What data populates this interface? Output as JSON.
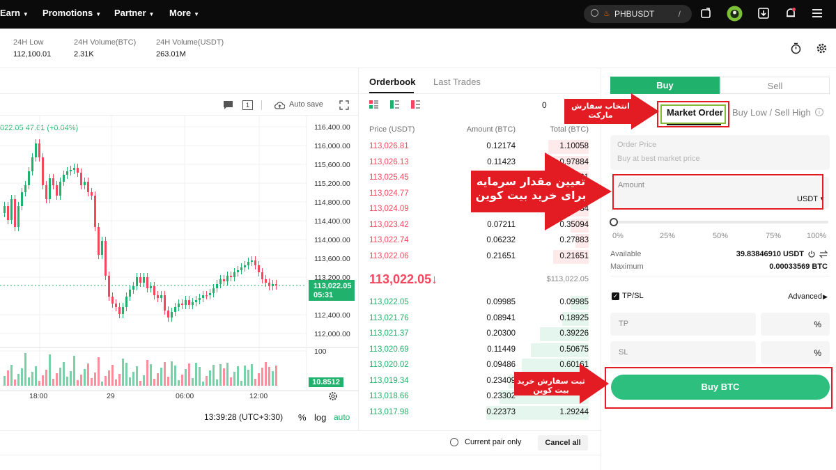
{
  "nav": {
    "items": [
      "Earn",
      "Promotions",
      "Partner",
      "More"
    ],
    "search_text": "PHBUSDT",
    "search_slash": "/"
  },
  "stats": [
    {
      "label": "24H Low",
      "value": "112,100.01"
    },
    {
      "label": "24H Volume(BTC)",
      "value": "2.31K"
    },
    {
      "label": "24H Volume(USDT)",
      "value": "263.01M"
    }
  ],
  "chart": {
    "autosave_label": "Auto save",
    "interval_badge": "1",
    "ohlc_text": "022.05  47.61 (+0.04%)",
    "price_ticks": [
      "116,400.00",
      "116,000.00",
      "115,600.00",
      "115,200.00",
      "114,800.00",
      "114,400.00",
      "114,000.00",
      "113,600.00",
      "113,200.00",
      "112,400.00",
      "112,000.00",
      "100"
    ],
    "current_price": "113,022.05",
    "countdown": "05:31",
    "volume_value": "10.8512",
    "time_ticks": [
      "18:00",
      "29",
      "06:00",
      "12:00"
    ],
    "clock": "13:39:28 (UTC+3:30)",
    "scale_pct": "%",
    "scale_log": "log",
    "scale_auto": "auto"
  },
  "orderbook": {
    "tabs": [
      "Orderbook",
      "Last Trades"
    ],
    "headers": {
      "price": "Price (USDT)",
      "amount": "Amount (BTC)",
      "total": "Total (BTC)"
    },
    "precision_stub": "0",
    "asks": [
      {
        "price": "113,026.81",
        "amount": "0.12174",
        "total": "1.10058",
        "depth": 0.18
      },
      {
        "price": "113,026.13",
        "amount": "0.11423",
        "total": "0.97884",
        "depth": 0.16
      },
      {
        "price": "113,025.45",
        "amount": "",
        "total": "61",
        "depth": 0.14
      },
      {
        "price": "113,024.77",
        "amount": "",
        "total": "",
        "depth": 0.12
      },
      {
        "price": "113,024.09",
        "amount": "",
        "total": "34",
        "depth": 0.1
      },
      {
        "price": "113,023.42",
        "amount": "0.07211",
        "total": "0.35094",
        "depth": 0.08
      },
      {
        "price": "113,022.74",
        "amount": "0.06232",
        "total": "0.27883",
        "depth": 0.06
      },
      {
        "price": "113,022.06",
        "amount": "0.21651",
        "total": "0.21651",
        "depth": 0.16
      }
    ],
    "last_price": "113,022.05",
    "last_arrow": "↓",
    "last_fiat": "$113,022.05",
    "bids": [
      {
        "price": "113,022.05",
        "amount": "0.09985",
        "total": "0.09985",
        "depth": 0.08
      },
      {
        "price": "113,021.76",
        "amount": "0.08941",
        "total": "0.18925",
        "depth": 0.12
      },
      {
        "price": "113,021.37",
        "amount": "0.20300",
        "total": "0.39226",
        "depth": 0.22
      },
      {
        "price": "113,020.69",
        "amount": "0.11449",
        "total": "0.50675",
        "depth": 0.26
      },
      {
        "price": "113,020.02",
        "amount": "0.09486",
        "total": "0.60161",
        "depth": 0.3
      },
      {
        "price": "113,019.34",
        "amount": "0.23409",
        "total": "",
        "depth": 0.36
      },
      {
        "price": "113,018.66",
        "amount": "0.23302",
        "total": "",
        "depth": 0.4
      },
      {
        "price": "113,017.98",
        "amount": "0.22373",
        "total": "1.29244",
        "depth": 0.46
      }
    ]
  },
  "bottom": {
    "current_pair_only": "Current pair only",
    "cancel_all": "Cancel all"
  },
  "form": {
    "buy_tab": "Buy",
    "sell_tab": "Sell",
    "market_order": "Market Order",
    "buy_low_sell_high": "Buy Low / Sell High",
    "order_price_label": "Order Price",
    "order_price_placeholder": "Buy at best market price",
    "amount_label": "Amount",
    "amount_unit": "USDT",
    "slider_marks": [
      "0%",
      "25%",
      "50%",
      "75%",
      "100%"
    ],
    "slider_fraction": 0,
    "available_label": "Available",
    "available_value": "39.83846910 USDT",
    "maximum_label": "Maximum",
    "maximum_value": "0.00033569 BTC",
    "tpsl_label": "TP/SL",
    "advanced_label": "Advanced",
    "tp_label": "TP",
    "sl_label": "SL",
    "pct": "%",
    "buy_button": "Buy BTC"
  },
  "annotations": {
    "market_order_note_1": "انتخاب سفارش",
    "market_order_note_2": "مارکت",
    "amount_note_1": "تعیین مقدار سرمایه",
    "amount_note_2": "برای خرید بیت کوین",
    "buy_note_1": "ثبت سفارش خرید",
    "buy_note_2": "بیت کوین"
  },
  "colors": {
    "green": "#20b26c",
    "red": "#f6465d",
    "annotation_red": "#e31b23",
    "button_green": "#2cbf7e"
  }
}
